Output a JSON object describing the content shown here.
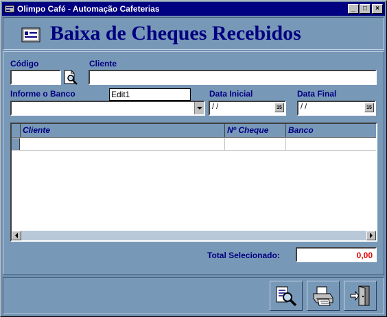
{
  "window": {
    "title": "Olimpo Café - Automação Cafeterias",
    "min_label": "_",
    "max_label": "□",
    "close_label": "×"
  },
  "header": {
    "title": "Baixa de Cheques Recebidos"
  },
  "form": {
    "codigo_label": "Código",
    "codigo_value": "",
    "cliente_label": "Cliente",
    "cliente_value": "",
    "banco_label": "Informe o Banco",
    "edit1_value": "Edit1",
    "banco_value": "",
    "data_inicial_label": "Data Inicial",
    "data_inicial_value": " /  /",
    "data_final_label": "Data Final",
    "data_final_value": " /  /",
    "calendar_glyph": "15"
  },
  "grid": {
    "columns": [
      "Cliente",
      "Nº Cheque",
      "Banco"
    ],
    "rows": [
      [
        "",
        "",
        ""
      ]
    ]
  },
  "totals": {
    "label": "Total Selecionado:",
    "value": "0,00"
  },
  "colors": {
    "title_bar": "#000080",
    "label_text": "#000080",
    "total_value": "#e00000",
    "panel_bg": "#7898b8"
  },
  "icons": {
    "header": "card-index-icon",
    "codigo_lookup": "document-magnifier-icon",
    "footer": [
      "search-icon",
      "printer-icon",
      "exit-door-icon"
    ]
  }
}
